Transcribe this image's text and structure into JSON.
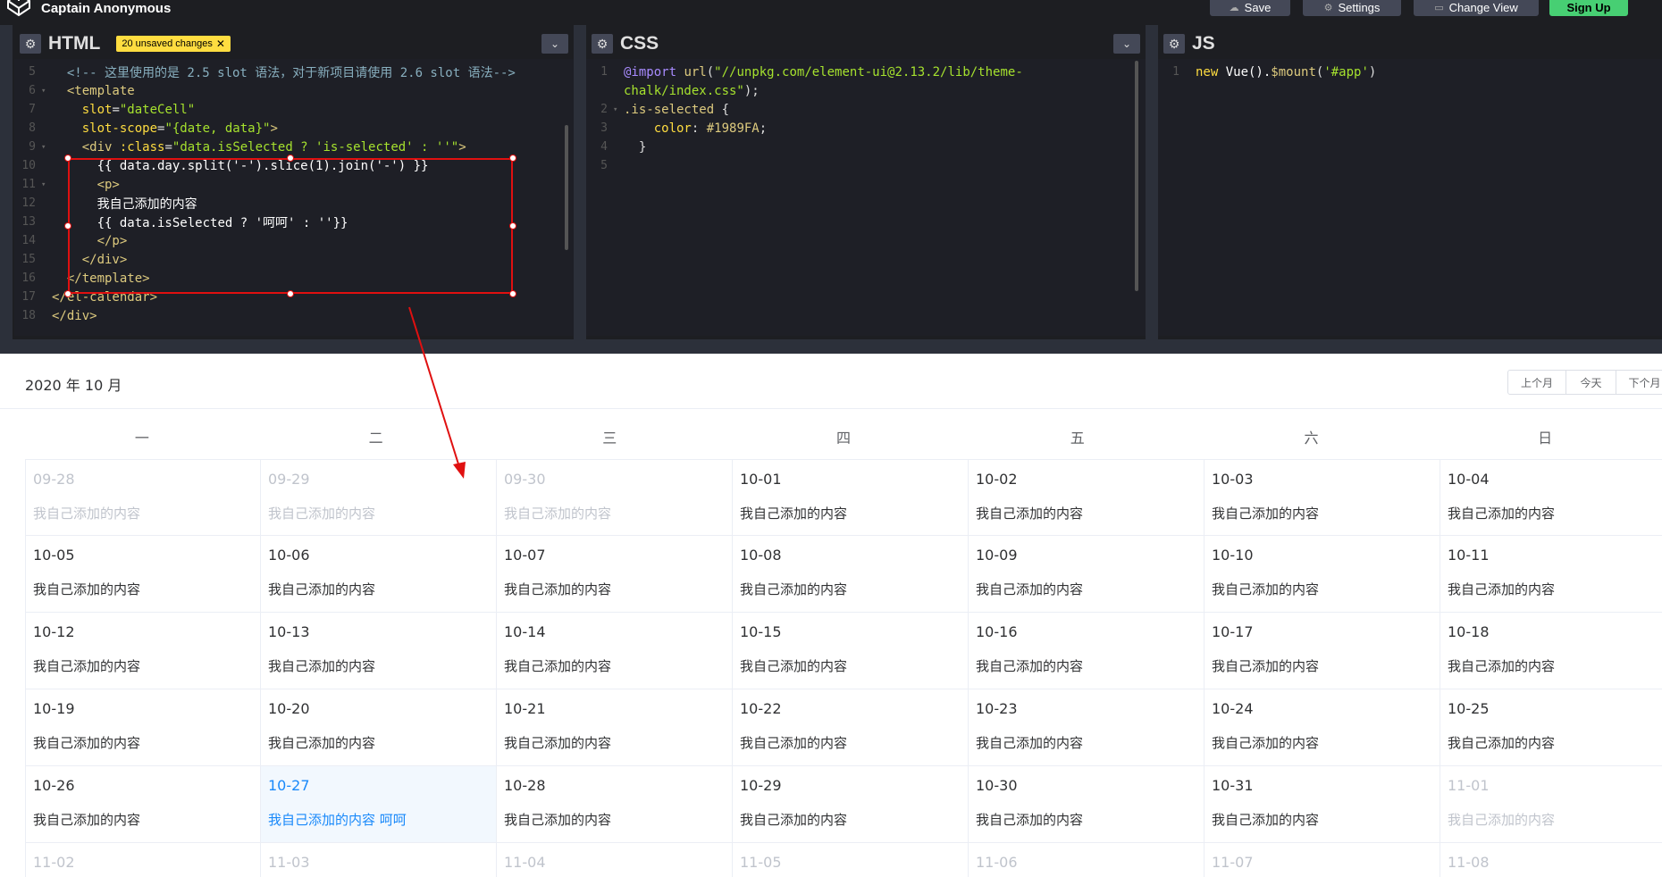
{
  "topbar": {
    "user_name": "Captain Anonymous",
    "buttons": {
      "save": "Save",
      "settings": "Settings",
      "change_view": "Change View",
      "signup": "Sign Up"
    }
  },
  "panes": {
    "html": {
      "title": "HTML",
      "unsaved_badge": "20 unsaved changes"
    },
    "css": {
      "title": "CSS"
    },
    "js": {
      "title": "JS"
    }
  },
  "html_code": [
    {
      "n": "5",
      "fold": false,
      "indent": "  ",
      "parts": [
        [
          "c-comment",
          "<!-- 这里使用的是 2.5 slot 语法，对于新项目请使用 2.6 slot 语法-->"
        ]
      ]
    },
    {
      "n": "6",
      "fold": true,
      "indent": "  ",
      "parts": [
        [
          "c-tag",
          "<template"
        ]
      ]
    },
    {
      "n": "7",
      "fold": false,
      "indent": "    ",
      "parts": [
        [
          "c-attr",
          "slot"
        ],
        [
          "txt",
          "="
        ],
        [
          "c-str",
          "\"dateCell\""
        ]
      ]
    },
    {
      "n": "8",
      "fold": false,
      "indent": "    ",
      "parts": [
        [
          "c-attr",
          "slot-scope"
        ],
        [
          "txt",
          "="
        ],
        [
          "c-str",
          "\"{date, data}\""
        ],
        [
          "c-tag",
          ">"
        ]
      ]
    },
    {
      "n": "9",
      "fold": true,
      "indent": "    ",
      "parts": [
        [
          "c-tag",
          "<div "
        ],
        [
          "c-attr",
          ":class"
        ],
        [
          "txt",
          "="
        ],
        [
          "c-str",
          "\"data.isSelected ? 'is-selected' : ''\""
        ],
        [
          "c-tag",
          ">"
        ]
      ]
    },
    {
      "n": "10",
      "fold": false,
      "indent": "      ",
      "parts": [
        [
          "c-white",
          "{{ data.day.split('-').slice(1).join('-') }}"
        ]
      ]
    },
    {
      "n": "11",
      "fold": true,
      "indent": "      ",
      "parts": [
        [
          "c-tag",
          "<p>"
        ]
      ]
    },
    {
      "n": "12",
      "fold": false,
      "indent": "      ",
      "parts": [
        [
          "c-white",
          "我自己添加的内容"
        ]
      ]
    },
    {
      "n": "13",
      "fold": false,
      "indent": "      ",
      "parts": [
        [
          "c-white",
          "{{ data.isSelected ? '呵呵' : ''}}"
        ]
      ]
    },
    {
      "n": "14",
      "fold": false,
      "indent": "      ",
      "parts": [
        [
          "c-tag",
          "</p>"
        ]
      ]
    },
    {
      "n": "15",
      "fold": false,
      "indent": "    ",
      "parts": [
        [
          "c-tag",
          "</div>"
        ]
      ]
    },
    {
      "n": "16",
      "fold": false,
      "indent": "  ",
      "parts": [
        [
          "c-tag",
          "</template>"
        ]
      ]
    },
    {
      "n": "17",
      "fold": false,
      "indent": "",
      "parts": [
        [
          "c-tag",
          "</el-calendar>"
        ]
      ]
    },
    {
      "n": "18",
      "fold": false,
      "indent": "",
      "parts": [
        [
          "c-tag",
          "</div>"
        ]
      ]
    }
  ],
  "css_code": [
    {
      "n": "1",
      "fold": false,
      "indent": "",
      "parts": [
        [
          "c-at",
          "@import "
        ],
        [
          "c-fn",
          "url"
        ],
        [
          "txt",
          "("
        ],
        [
          "c-str",
          "\"//unpkg.com/element-ui@2.13.2/lib/theme-"
        ]
      ]
    },
    {
      "n": "",
      "fold": false,
      "indent": "",
      "parts": [
        [
          "c-str",
          "chalk/index.css\""
        ],
        [
          "txt",
          ");"
        ]
      ]
    },
    {
      "n": "2",
      "fold": true,
      "indent": "",
      "parts": [
        [
          "c-sel",
          ".is-selected"
        ],
        [
          "txt",
          " {"
        ]
      ]
    },
    {
      "n": "3",
      "fold": false,
      "indent": "    ",
      "parts": [
        [
          "c-prop",
          "color"
        ],
        [
          "txt",
          ": "
        ],
        [
          "c-val",
          "#1989FA"
        ],
        [
          "txt",
          ";"
        ]
      ]
    },
    {
      "n": "4",
      "fold": false,
      "indent": "  ",
      "parts": [
        [
          "txt",
          "}"
        ]
      ]
    },
    {
      "n": "5",
      "fold": false,
      "indent": "",
      "parts": []
    }
  ],
  "js_code": [
    {
      "n": "1",
      "fold": false,
      "indent": "",
      "parts": [
        [
          "c-attr",
          "new "
        ],
        [
          "c-white",
          "Vue()."
        ],
        [
          "c-fn",
          "$mount"
        ],
        [
          "txt",
          "("
        ],
        [
          "c-str",
          "'#app'"
        ],
        [
          "txt",
          ")"
        ]
      ]
    }
  ],
  "calendar": {
    "title": "2020 年 10 月",
    "buttons": {
      "prev": "上个月",
      "today": "今天",
      "next": "下个月"
    },
    "weekdays": [
      "一",
      "二",
      "三",
      "四",
      "五",
      "六",
      "日"
    ],
    "cell_text": "我自己添加的内容",
    "selected_extra": "呵呵",
    "accent_color": "#1989FA",
    "weeks": [
      [
        [
          "09-28",
          "prev"
        ],
        [
          "09-29",
          "prev"
        ],
        [
          "09-30",
          "prev"
        ],
        [
          "10-01",
          "cur"
        ],
        [
          "10-02",
          "cur"
        ],
        [
          "10-03",
          "cur"
        ],
        [
          "10-04",
          "cur"
        ]
      ],
      [
        [
          "10-05",
          "cur"
        ],
        [
          "10-06",
          "cur"
        ],
        [
          "10-07",
          "cur"
        ],
        [
          "10-08",
          "cur"
        ],
        [
          "10-09",
          "cur"
        ],
        [
          "10-10",
          "cur"
        ],
        [
          "10-11",
          "cur"
        ]
      ],
      [
        [
          "10-12",
          "cur"
        ],
        [
          "10-13",
          "cur"
        ],
        [
          "10-14",
          "cur"
        ],
        [
          "10-15",
          "cur"
        ],
        [
          "10-16",
          "cur"
        ],
        [
          "10-17",
          "cur"
        ],
        [
          "10-18",
          "cur"
        ]
      ],
      [
        [
          "10-19",
          "cur"
        ],
        [
          "10-20",
          "cur"
        ],
        [
          "10-21",
          "cur"
        ],
        [
          "10-22",
          "cur"
        ],
        [
          "10-23",
          "cur"
        ],
        [
          "10-24",
          "cur"
        ],
        [
          "10-25",
          "cur"
        ]
      ],
      [
        [
          "10-26",
          "cur"
        ],
        [
          "10-27",
          "selected"
        ],
        [
          "10-28",
          "cur"
        ],
        [
          "10-29",
          "cur"
        ],
        [
          "10-30",
          "cur"
        ],
        [
          "10-31",
          "cur"
        ],
        [
          "11-01",
          "next"
        ]
      ],
      [
        [
          "11-02",
          "next"
        ],
        [
          "11-03",
          "next"
        ],
        [
          "11-04",
          "next"
        ],
        [
          "11-05",
          "next"
        ],
        [
          "11-06",
          "next"
        ],
        [
          "11-07",
          "next"
        ],
        [
          "11-08",
          "next"
        ]
      ]
    ]
  }
}
